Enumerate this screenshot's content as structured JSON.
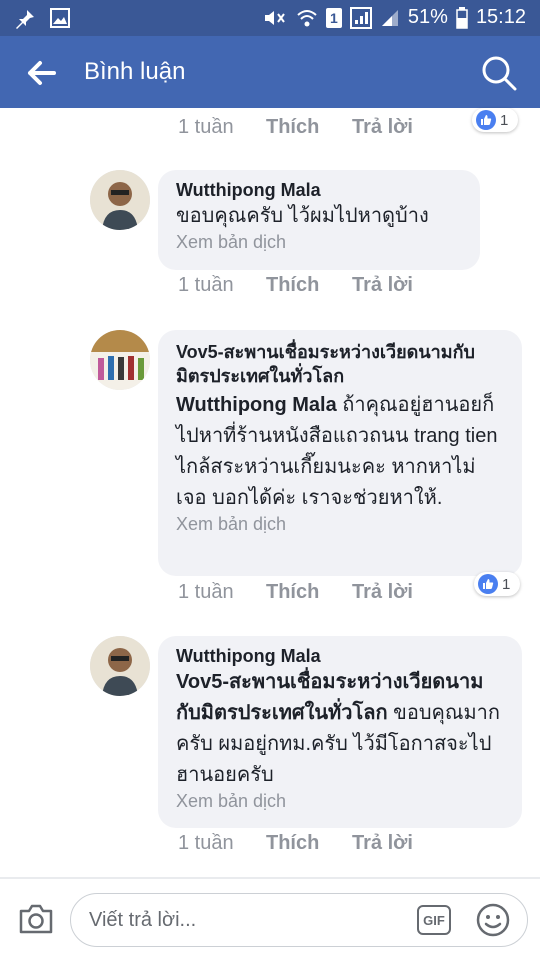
{
  "status_bar": {
    "battery": "51%",
    "time": "15:12",
    "sim": "1"
  },
  "appbar": {
    "title": "Bình luận"
  },
  "comments": [
    {
      "meta": {
        "time": "1 tuần",
        "like": "Thích",
        "reply": "Trả lời"
      },
      "reaction_count": "1"
    },
    {
      "author": "Wutthipong Mala",
      "text": "ขอบคุณครับ ไว้ผมไปหาดูบ้าง",
      "translate": "Xem bản dịch",
      "meta": {
        "time": "1 tuần",
        "like": "Thích",
        "reply": "Trả lời"
      }
    },
    {
      "author": "Vov5-สะพานเชื่อมระหว่างเวียดนามกับมิตรประเทศในทั่วโลก",
      "mention": "Wutthipong Mala",
      "text": "ถ้าคุณอยู่ฮานอยก็ไปหาที่ร้านหนังสือแถวถนน  trang tien ไกล้สระหว่านเกี๊ยมนะคะ หากหาไม่เจอ บอกได้ค่ะ เราจะช่วยหาให้.",
      "translate": "Xem bản dịch",
      "meta": {
        "time": "1 tuần",
        "like": "Thích",
        "reply": "Trả lời"
      },
      "reaction_count": "1"
    },
    {
      "author": "Wutthipong Mala",
      "mention": "Vov5-สะพานเชื่อมระหว่างเวียดนามกับมิตรประเทศในทั่วโลก",
      "text": "ขอบคุณมากครับ ผมอยู่กทม.ครับ ไว้มีโอกาสจะไปฮานอยครับ",
      "translate": "Xem bản dịch",
      "meta": {
        "time": "1 tuần",
        "like": "Thích",
        "reply": "Trả lời"
      }
    }
  ],
  "composer": {
    "placeholder": "Viết trả lời...",
    "gif_label": "GIF"
  },
  "colors": {
    "header": "#4267b2",
    "statusbar": "#3a5896",
    "bubble": "#f1f2f6",
    "like_blue": "#4a7ff0"
  }
}
